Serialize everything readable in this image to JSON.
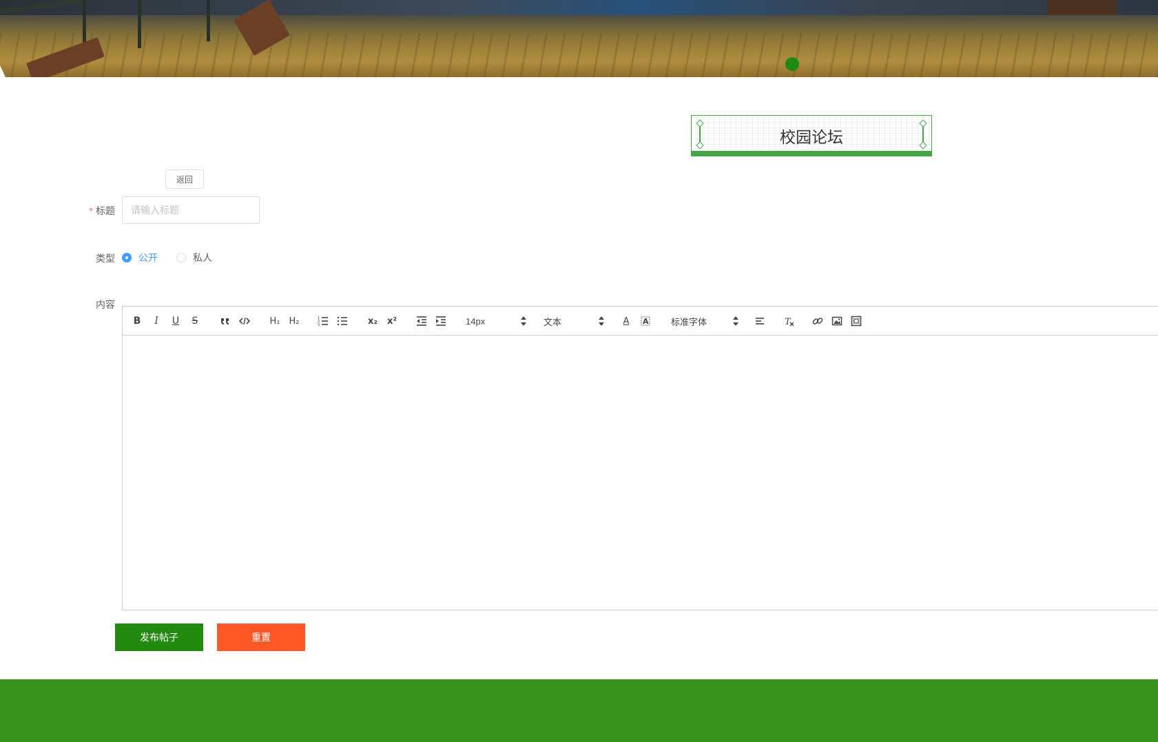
{
  "header": {
    "site_title": "校园论坛",
    "back_label": "返回"
  },
  "form": {
    "title_label": "标题",
    "required_mark": "*",
    "title_placeholder": "请输入标题",
    "title_value": "",
    "type_label": "类型",
    "type_options": [
      {
        "label": "公开",
        "checked": true
      },
      {
        "label": "私人",
        "checked": false
      }
    ],
    "content_label": "内容"
  },
  "editor": {
    "font_size": "14px",
    "header_select": "文本",
    "font_family": "标准字体",
    "icons": [
      "bold-icon",
      "italic-icon",
      "underline-icon",
      "strike-icon",
      "blockquote-icon",
      "code-block-icon",
      "h1-icon",
      "h2-icon",
      "ordered-list-icon",
      "bullet-list-icon",
      "subscript-icon",
      "superscript-icon",
      "outdent-icon",
      "indent-icon",
      "font-color-icon",
      "background-color-icon",
      "align-icon",
      "clear-format-icon",
      "link-icon",
      "image-icon",
      "video-icon"
    ],
    "labels": {
      "bold": "B",
      "italic": "I",
      "underline": "U",
      "strike": "S",
      "h1": "H₁",
      "h2": "H₂",
      "sub": "x₂",
      "sup": "x²",
      "color": "A"
    }
  },
  "actions": {
    "submit_label": "发布帖子",
    "reset_label": "重置"
  },
  "colors": {
    "primary_green": "#228b0f",
    "reset_orange": "#fd5725",
    "footer_green": "#38901d",
    "radio_blue": "#409eff"
  }
}
